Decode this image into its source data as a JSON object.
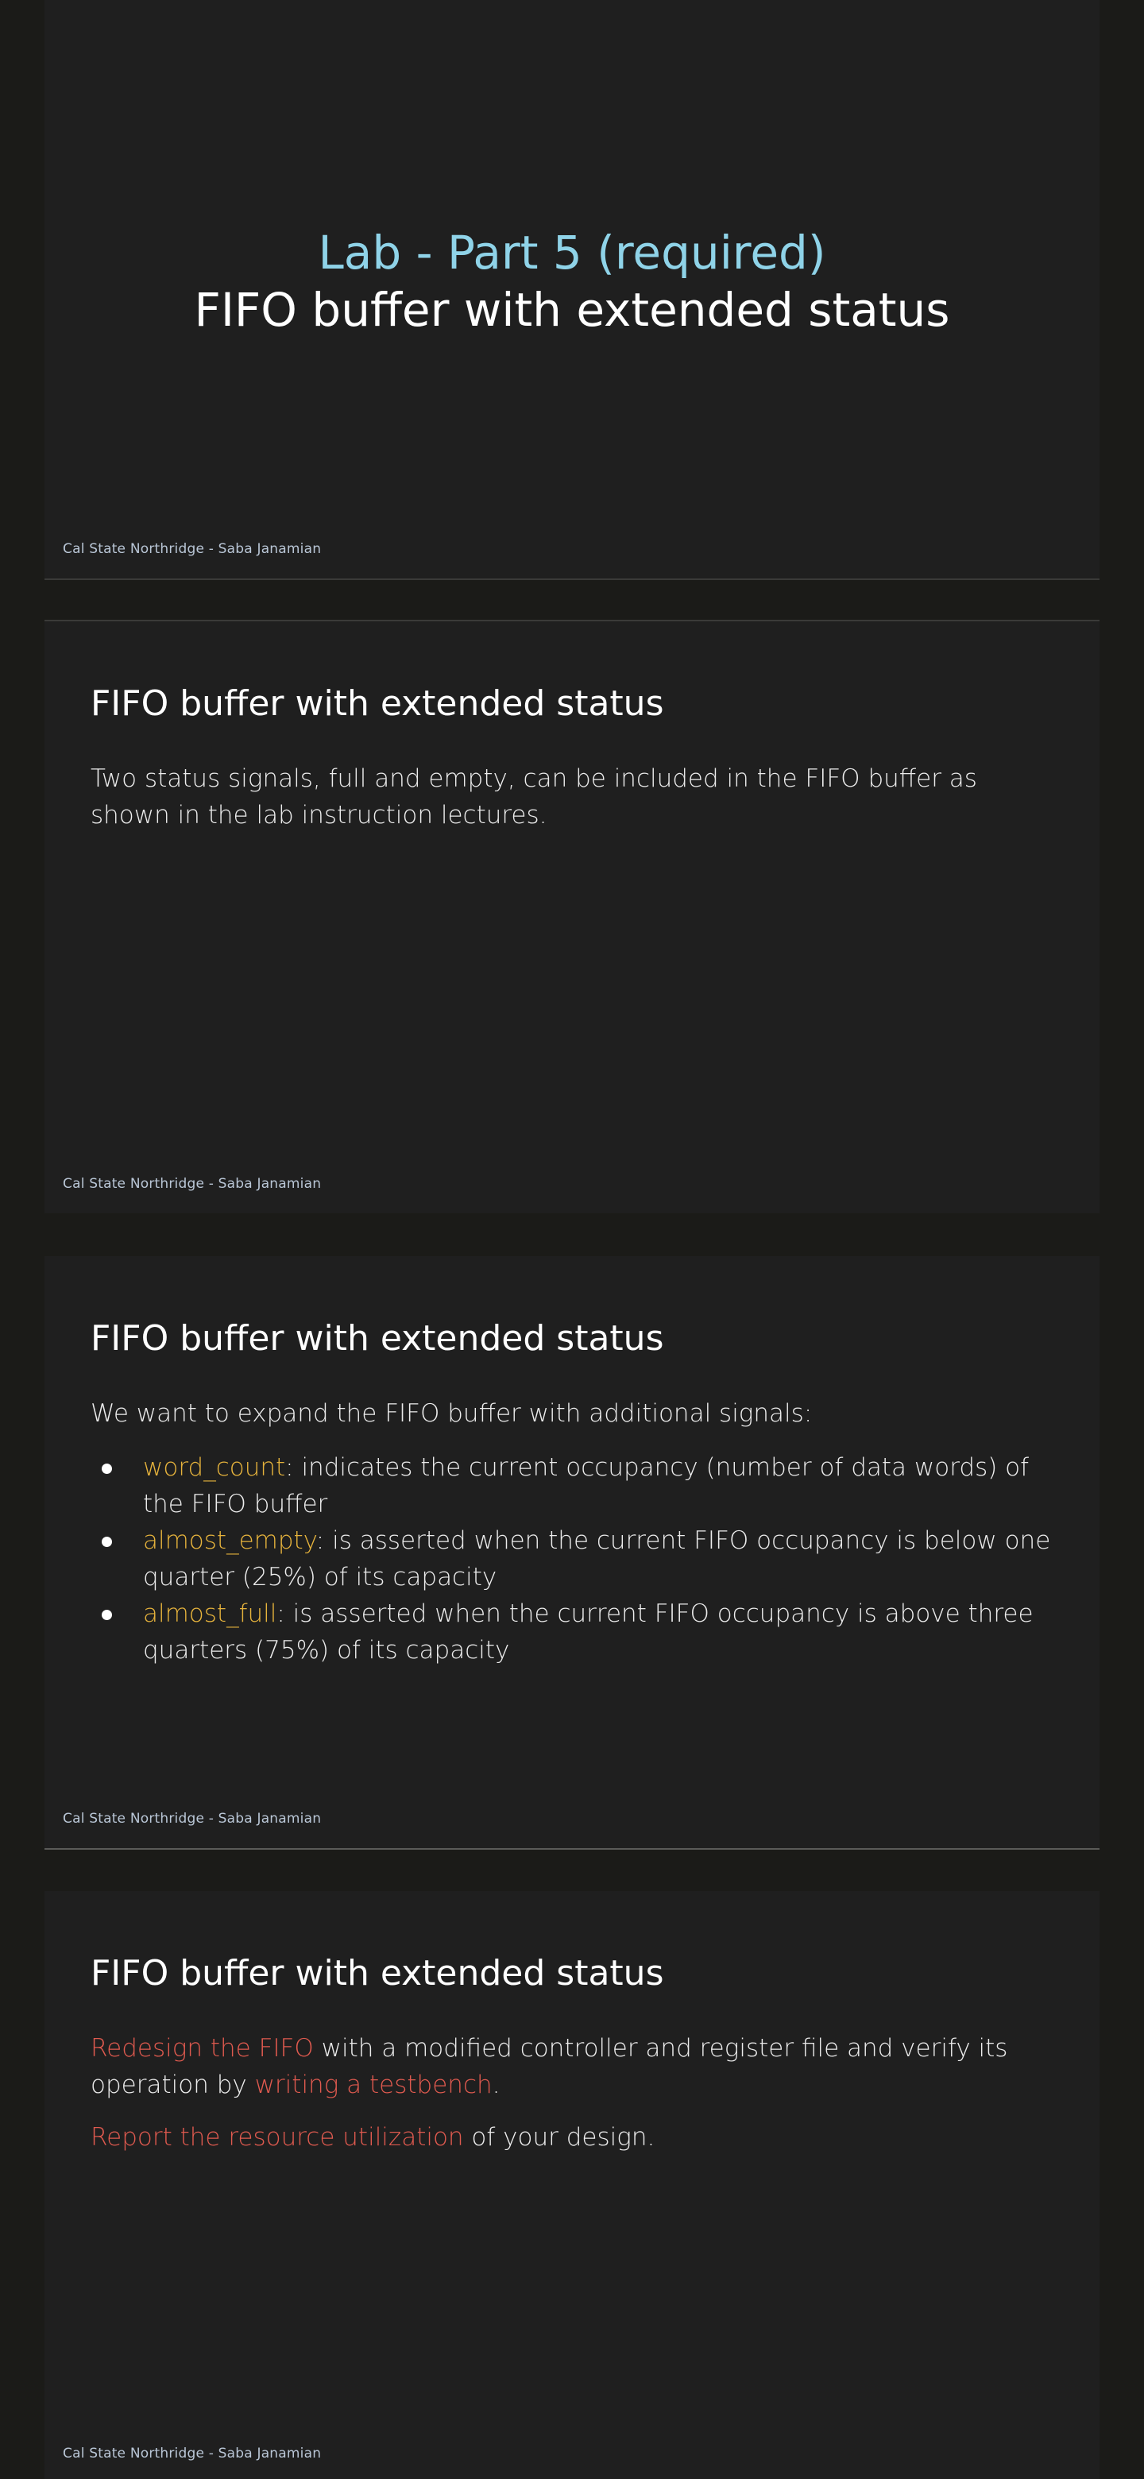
{
  "footer_text": "Cal State Northridge - Saba Janamian",
  "slide1": {
    "title_accent": "Lab - Part 5 (required)",
    "title_main": "FIFO buffer with extended status"
  },
  "slide2": {
    "heading": "FIFO buffer with extended status",
    "body": "Two status signals, full and empty, can be included in the FIFO buffer as shown in the lab instruction lectures."
  },
  "slide3": {
    "heading": "FIFO buffer with extended status",
    "intro": "We want to expand the FIFO buffer with additional signals:",
    "bullets": [
      {
        "term": "word_count",
        "desc": ": indicates the current occupancy (number of data words) of the FIFO buffer"
      },
      {
        "term": "almost_empty",
        "desc": ": is asserted when the current FIFO occupancy is below one quarter (25%) of its capacity"
      },
      {
        "term": "almost_full",
        "desc": ": is asserted when the current FIFO occupancy is above three quarters (75%) of its capacity"
      }
    ]
  },
  "slide4": {
    "heading": "FIFO buffer with extended status",
    "p1_hl1": "Redesign the FIFO",
    "p1_mid": " with a modified controller and register file and verify its operation by ",
    "p1_hl2": "writing a testbench",
    "p1_end": ".",
    "p2_hl": "Report the resource utilization",
    "p2_rest": " of your design."
  },
  "colors": {
    "background": "#1b1b18",
    "slide": "#1f1f1f",
    "title_accent": "#8fd3e8",
    "keyword": "#e6b33c",
    "highlight": "#e05a4f",
    "footer": "#b9c6d6"
  }
}
